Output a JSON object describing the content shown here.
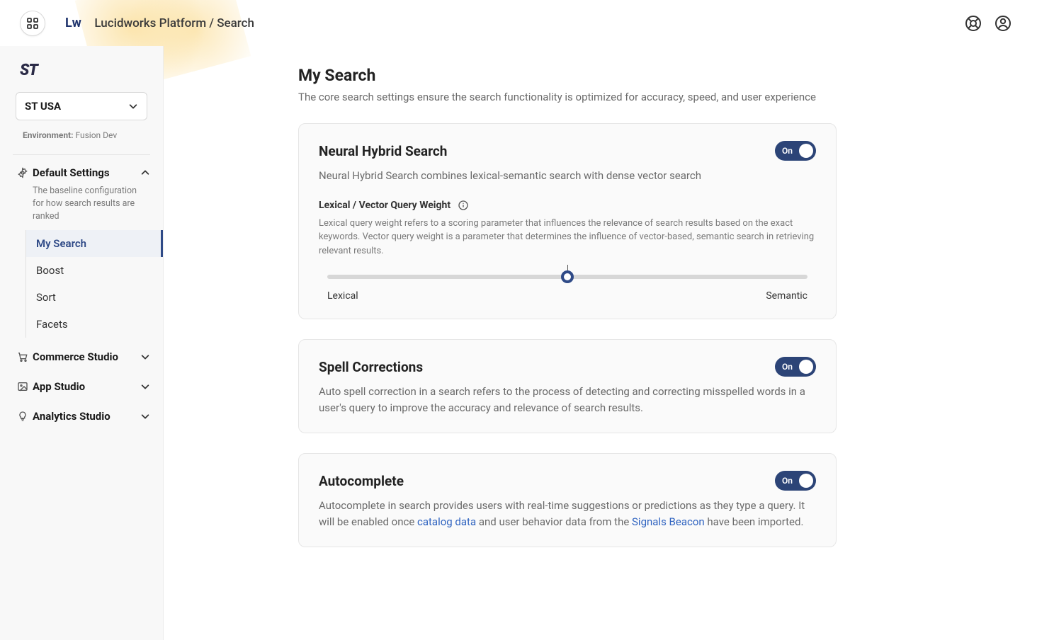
{
  "header": {
    "logo_text": "Lw",
    "breadcrumb": "Lucidworks Platform / Search"
  },
  "sidebar": {
    "brand": "ST",
    "region_selected": "ST USA",
    "env_label": "Environment:",
    "env_value": "Fusion Dev",
    "default_settings": {
      "label": "Default Settings",
      "desc": "The baseline configuration for how search results are ranked",
      "items": [
        "My Search",
        "Boost",
        "Sort",
        "Facets"
      ],
      "active_index": 0
    },
    "closed_sections": [
      {
        "label": "Commerce Studio"
      },
      {
        "label": "App Studio"
      },
      {
        "label": "Analytics Studio"
      }
    ]
  },
  "page": {
    "title": "My Search",
    "subtitle": "The core search settings ensure the search functionality is optimized for accuracy, speed, and user experience"
  },
  "cards": {
    "neural": {
      "title": "Neural Hybrid Search",
      "toggle_label": "On",
      "desc": "Neural Hybrid Search combines lexical-semantic search with dense vector search",
      "slider_label": "Lexical / Vector Query Weight",
      "slider_help": "Lexical query weight refers to a scoring parameter that influences the relevance of search results based on the exact keywords. Vector query weight is a parameter that determines the influence of vector-based, semantic search in retrieving relevant results.",
      "slider_left": "Lexical",
      "slider_right": "Semantic",
      "slider_value_percent": 50
    },
    "spell": {
      "title": "Spell Corrections",
      "toggle_label": "On",
      "desc": "Auto spell correction in a search refers to the process of detecting and correcting misspelled words in a user's query to improve the accuracy and relevance of search results."
    },
    "auto": {
      "title": "Autocomplete",
      "toggle_label": "On",
      "desc_prefix": "Autocomplete in search provides users with real-time suggestions or predictions as they type a query. It will be enabled once ",
      "link1": "catalog data",
      "desc_mid": " and user behavior data from the ",
      "link2": "Signals Beacon",
      "desc_suffix": " have been imported."
    }
  }
}
